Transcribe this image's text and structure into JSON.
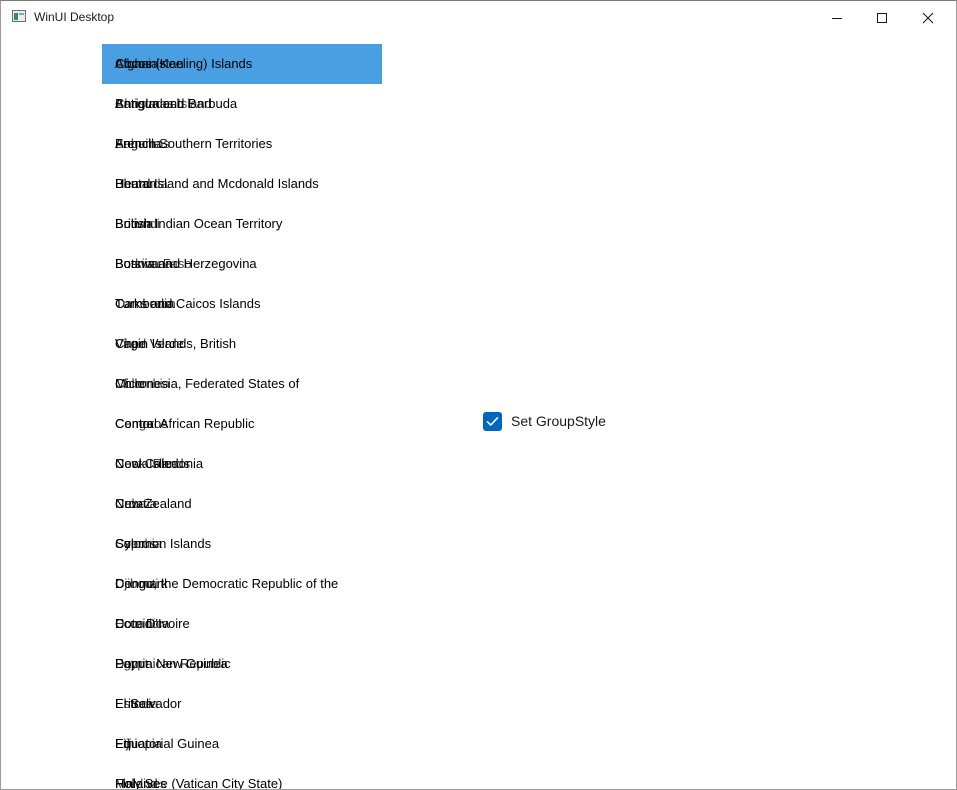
{
  "window": {
    "title": "WinUI Desktop"
  },
  "icons": {
    "app": "app-window-icon",
    "minimize": "minimize-icon",
    "maximize": "maximize-icon",
    "close": "close-icon",
    "check": "checkmark-icon"
  },
  "colors": {
    "selection": "#4a9fe2",
    "checkbox_accent": "#0067c0"
  },
  "list": {
    "items": [
      {
        "text": "Cocos (Keeling) Islands",
        "overlap": "Afghanistan",
        "overlap2": "Albania",
        "selected": true
      },
      {
        "text": "Antigua and Barbuda",
        "overlap": "Bangladesh",
        "overlap2": "Christmas Island"
      },
      {
        "text": "French Southern Territories",
        "overlap": "Anguilla",
        "overlap2": "Bahamas"
      },
      {
        "text": "Heard Island and Mcdonald Islands",
        "overlap": "Bhutan",
        "overlap2": "Bermuda"
      },
      {
        "text": "British Indian Ocean Territory",
        "overlap": "Bolivia",
        "overlap2": "Burundi"
      },
      {
        "text": "Bosnia and Herzegovina",
        "overlap": "Botswana",
        "overlap2": "Burkina Faso"
      },
      {
        "text": "Turks and Caicos Islands",
        "overlap": "Cambodia",
        "overlap2": "Cameroon"
      },
      {
        "text": "Virgin Islands, British",
        "overlap": "Cape Verde",
        "overlap2": "Chad"
      },
      {
        "text": "Micronesia, Federated States of",
        "overlap": "Chile",
        "overlap2": "Colombia"
      },
      {
        "text": "Central African Republic",
        "overlap": "Comoros",
        "overlap2": "Congo"
      },
      {
        "text": "New Caledonia",
        "overlap": "Cook Islands",
        "overlap2": "Costa Rica"
      },
      {
        "text": "New Zealand",
        "overlap": "Croatia",
        "overlap2": "Cuba"
      },
      {
        "text": "Solomon Islands",
        "overlap": "Cyprus",
        "overlap2": "Czechia"
      },
      {
        "text": "Congo, the Democratic Republic of the",
        "overlap": "Denmark",
        "overlap2": "Djibouti"
      },
      {
        "text": "Cote D'Ivoire",
        "overlap": "Dominica",
        "overlap2": "Ecuador"
      },
      {
        "text": "Papua New Guinea",
        "overlap": "Dominican Republic",
        "overlap2": "Egypt"
      },
      {
        "text": "El Salvador",
        "overlap": "Eritrea",
        "overlap2": "Estonia"
      },
      {
        "text": "Equatorial Guinea",
        "overlap": "Ethiopia",
        "overlap2": "Fiji"
      },
      {
        "text": "Holy See (Vatican City State)",
        "overlap": "Finland",
        "overlap2": "Maldives"
      }
    ]
  },
  "options": {
    "group_style_label": "Set GroupStyle",
    "group_style_checked": true
  }
}
